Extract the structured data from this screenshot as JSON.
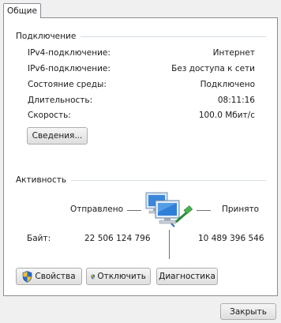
{
  "tab": {
    "label": "Общие"
  },
  "connection": {
    "title": "Подключение",
    "rows": [
      {
        "label": "IPv4-подключение:",
        "value": "Интернет"
      },
      {
        "label": "IPv6-подключение:",
        "value": "Без доступа к сети"
      },
      {
        "label": "Состояние среды:",
        "value": "Подключено"
      },
      {
        "label": "Длительность:",
        "value": "08:11:16"
      },
      {
        "label": "Скорость:",
        "value": "100.0 Мбит/с"
      }
    ],
    "details_button": "Сведения..."
  },
  "activity": {
    "title": "Активность",
    "sent_label": "Отправлено",
    "received_label": "Принято",
    "bytes_label": "Байт:",
    "bytes_sent": "22 506 124 796",
    "bytes_received": "10 489 396 546",
    "icon": "network-computers-icon"
  },
  "buttons": {
    "properties": "Свойства",
    "disable": "Отключить",
    "diagnose": "Диагностика",
    "close": "Закрыть"
  },
  "colors": {
    "shield_blue": "#2a6ac7",
    "shield_yellow": "#f2c02d",
    "monitor_blue": "#2f7fd8"
  }
}
